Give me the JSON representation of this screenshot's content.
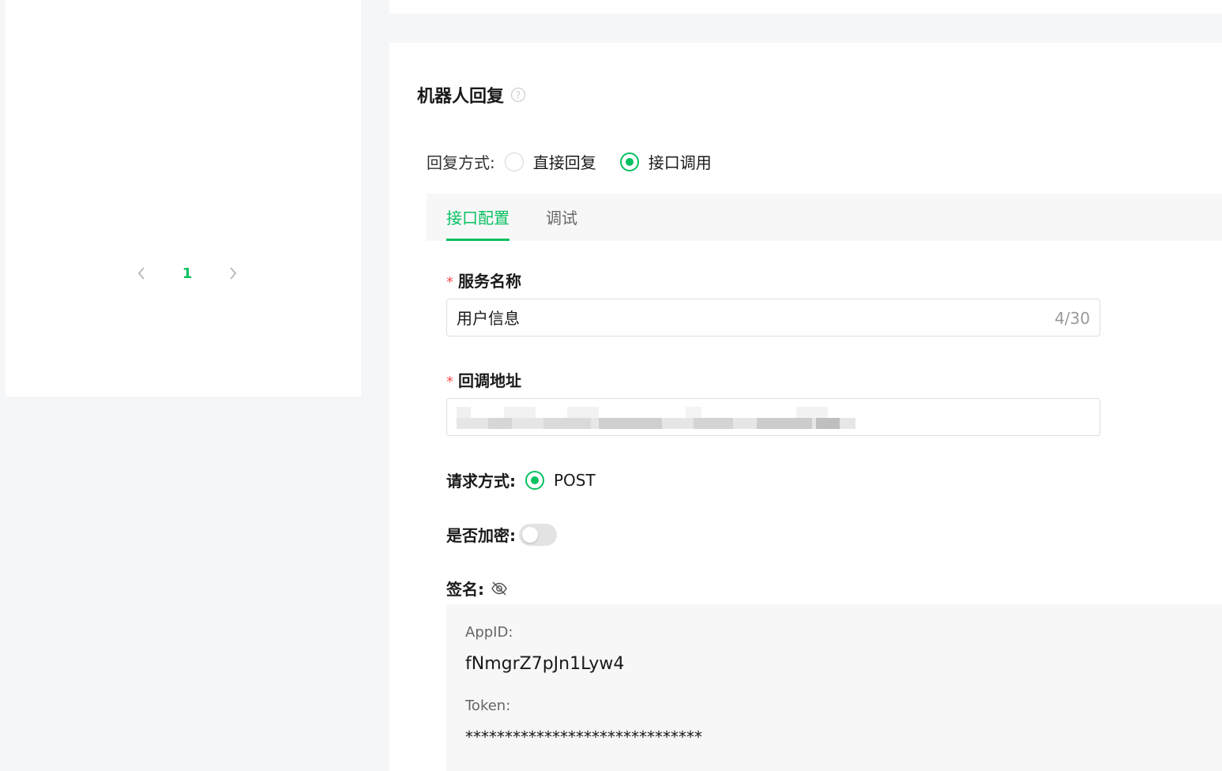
{
  "pagination": {
    "prev_icon": "chevron-left-icon",
    "current_page": "1",
    "next_icon": "chevron-right-icon"
  },
  "section": {
    "title": "机器人回复",
    "help_icon": "question-circle-icon"
  },
  "reply_mode": {
    "label": "回复方式:",
    "options": [
      {
        "label": "直接回复",
        "checked": false
      },
      {
        "label": "接口调用",
        "checked": true
      }
    ]
  },
  "tabs": [
    {
      "label": "接口配置",
      "active": true
    },
    {
      "label": "调试",
      "active": false
    }
  ],
  "form": {
    "required_mark": "*",
    "service_name": {
      "label": "服务名称",
      "value": "用户信息",
      "count": "4/30"
    },
    "callback_url": {
      "label": "回调地址",
      "value": ""
    },
    "method": {
      "label": "请求方式:",
      "option": "POST",
      "checked": true
    },
    "encrypt": {
      "label": "是否加密:",
      "enabled": false
    },
    "signature": {
      "label": "签名:",
      "visibility_icon": "eye-off-icon",
      "appid_label": "AppID:",
      "appid_value": "fNmgrZ7pJn1Lyw4",
      "token_label": "Token:",
      "token_value": "******************************"
    }
  },
  "colors": {
    "accent": "#07c160",
    "required": "#fa5151",
    "page_bg": "#f5f6f7"
  }
}
